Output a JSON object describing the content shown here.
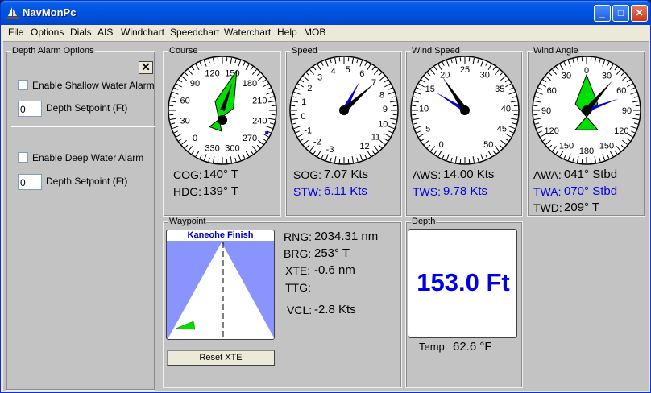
{
  "window": {
    "title": "NavMonPc",
    "min_glyph": "_",
    "max_glyph": "□",
    "close_glyph": "✕"
  },
  "menu": [
    "File",
    "Options",
    "Dials",
    "AIS",
    "Windchart",
    "Speedchart",
    "Waterchart",
    "Help",
    "MOB"
  ],
  "depth_alarm": {
    "title": "Depth Alarm Options",
    "close_glyph": "✕",
    "shallow_label": "Enable Shallow Water Alarm",
    "shallow_checked": false,
    "shallow_setpoint": "0",
    "deep_label": "Enable Deep Water Alarm",
    "deep_checked": false,
    "deep_setpoint": "0",
    "setpoint_label": "Depth Setpoint (Ft)"
  },
  "course": {
    "title": "Course",
    "ticks": [
      "150",
      "180",
      "210",
      "240",
      "270",
      "300",
      "330",
      "0",
      "30",
      "60",
      "90",
      "120"
    ],
    "cog_label": "COG:",
    "cog_value": "140° T",
    "hdg_label": "HDG:",
    "hdg_value": "139° T",
    "heading": 139
  },
  "speed": {
    "title": "Speed",
    "ticks": [
      "-3",
      "-2",
      "-1",
      "0",
      "1",
      "2",
      "3",
      "4",
      "5",
      "6",
      "7",
      "8",
      "9",
      "10",
      "11",
      "12"
    ],
    "sog_label": "SOG:",
    "sog_value": "7.07 Kts",
    "stw_label": "STW:",
    "stw_value": "6.11 Kts",
    "sog": 7.07,
    "stw": 6.11
  },
  "wind_speed": {
    "title": "Wind Speed",
    "ticks": [
      "0",
      "5",
      "10",
      "15",
      "20",
      "25",
      "30",
      "35",
      "40",
      "45",
      "50"
    ],
    "aws_label": "AWS:",
    "aws_value": "14.00 Kts",
    "tws_label": "TWS:",
    "tws_value": "9.78 Kts",
    "aws": 14.0,
    "tws": 9.78
  },
  "wind_angle": {
    "title": "Wind Angle",
    "ticks": [
      "0",
      "30",
      "60",
      "90",
      "120",
      "150",
      "180",
      "150",
      "120",
      "90",
      "60",
      "30"
    ],
    "awa_label": "AWA:",
    "awa_value": "041° Stbd",
    "twa_label": "TWA:",
    "twa_value": "070° Stbd",
    "twd_label": "TWD:",
    "twd_value": "209° T",
    "awa": 41,
    "twa": 70
  },
  "waypoint": {
    "title": "Waypoint",
    "name": "Kaneohe Finish",
    "rng_label": "RNG:",
    "rng_value": "2034.31 nm",
    "brg_label": "BRG:",
    "brg_value": "253° T",
    "xte_label": "XTE:",
    "xte_value": "-0.6 nm",
    "ttg_label": "TTG:",
    "vcl_label": "VCL:",
    "vcl_value": "-2.8 Kts",
    "reset_label": "Reset XTE"
  },
  "depth": {
    "title": "Depth",
    "value": "153.0 Ft",
    "temp_label": "Temp",
    "temp_value": "62.6 °F"
  },
  "colors": {
    "needle_green": "#00e000",
    "needle_blue": "#0000e0",
    "title_blue": "#0054e3"
  }
}
